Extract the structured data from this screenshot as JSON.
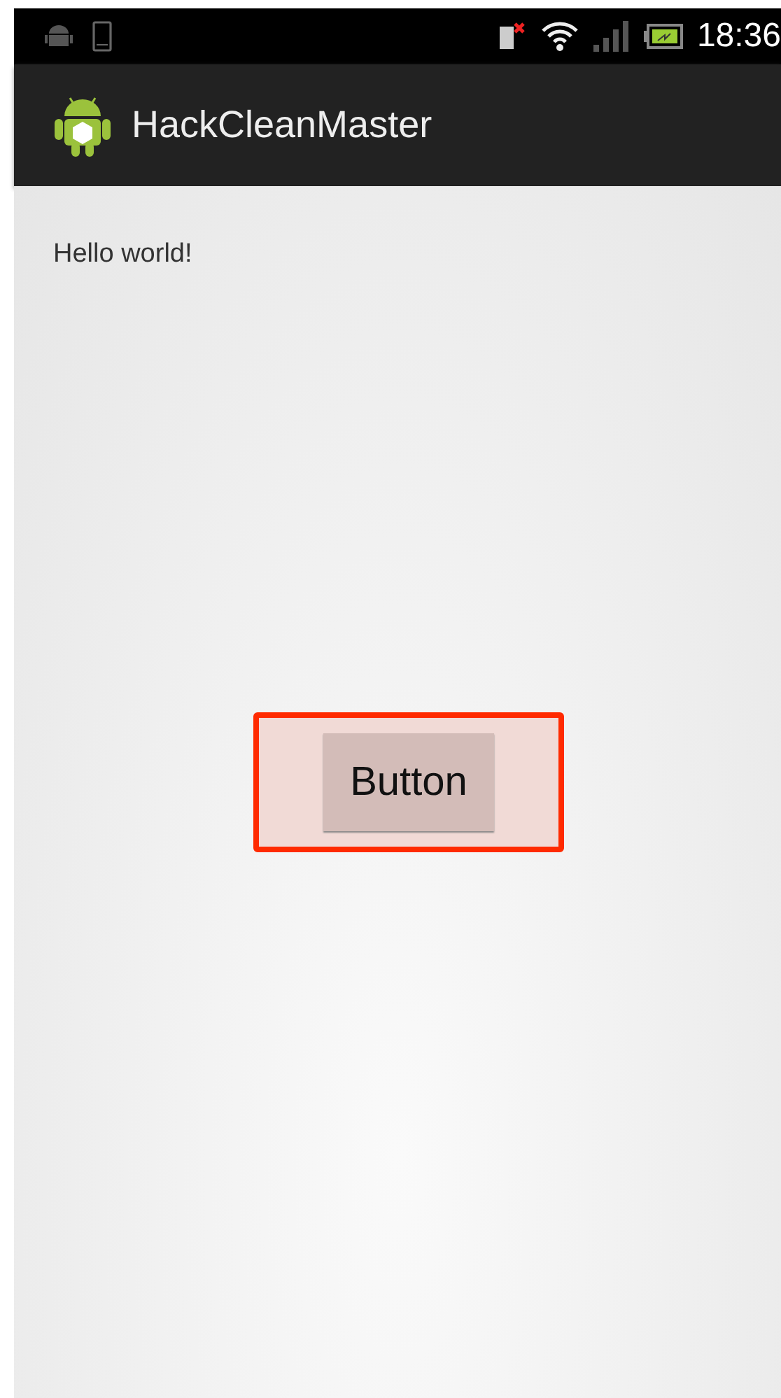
{
  "status_bar": {
    "time": "18:36"
  },
  "action_bar": {
    "title": "HackCleanMaster"
  },
  "content": {
    "text": "Hello world!",
    "button": {
      "label": "Button",
      "highlighted": true
    }
  }
}
